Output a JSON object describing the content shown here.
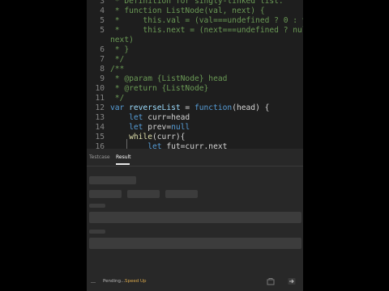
{
  "editor": {
    "lines": [
      {
        "num": "3",
        "tokens": [
          {
            "t": " * Definition for singly-linked list.",
            "c": "c-comment"
          }
        ]
      },
      {
        "num": "4",
        "tokens": [
          {
            "t": " * function ListNode(val, next) {",
            "c": "c-comment"
          }
        ]
      },
      {
        "num": "5",
        "tokens": [
          {
            "t": " *     this.val = (val===undefined ? 0 : val)",
            "c": "c-comment"
          }
        ]
      },
      {
        "num": "5",
        "tokens": [
          {
            "t": " *     this.next = (next===undefined ? null : ",
            "c": "c-comment"
          }
        ]
      },
      {
        "num": "",
        "tokens": [
          {
            "t": "next)",
            "c": "c-comment"
          }
        ]
      },
      {
        "num": "6",
        "tokens": [
          {
            "t": " * }",
            "c": "c-comment"
          }
        ]
      },
      {
        "num": "7",
        "tokens": [
          {
            "t": " */",
            "c": "c-comment"
          }
        ]
      },
      {
        "num": "8",
        "tokens": [
          {
            "t": "/**",
            "c": "c-comment"
          }
        ]
      },
      {
        "num": "9",
        "tokens": [
          {
            "t": " * @param {ListNode} head",
            "c": "c-comment"
          }
        ]
      },
      {
        "num": "10",
        "tokens": [
          {
            "t": " * @return {ListNode}",
            "c": "c-comment"
          }
        ]
      },
      {
        "num": "11",
        "tokens": [
          {
            "t": " */",
            "c": "c-comment"
          }
        ]
      },
      {
        "num": "12",
        "tokens": [
          {
            "t": "var ",
            "c": "c-kw"
          },
          {
            "t": "reverseList",
            "c": "c-var"
          },
          {
            "t": " = ",
            "c": ""
          },
          {
            "t": "function",
            "c": "c-kw"
          },
          {
            "t": "(head) {",
            "c": ""
          }
        ]
      },
      {
        "num": "13",
        "tokens": [
          {
            "t": "    ",
            "c": ""
          },
          {
            "t": "let ",
            "c": "c-kw"
          },
          {
            "t": "curr=head",
            "c": ""
          }
        ]
      },
      {
        "num": "14",
        "tokens": [
          {
            "t": "    ",
            "c": ""
          },
          {
            "t": "let ",
            "c": "c-kw"
          },
          {
            "t": "prev=",
            "c": ""
          },
          {
            "t": "null",
            "c": "c-kw"
          }
        ]
      },
      {
        "num": "15",
        "tokens": [
          {
            "t": "    ",
            "c": ""
          },
          {
            "t": "while",
            "c": "c-fn"
          },
          {
            "t": "(curr){",
            "c": ""
          }
        ]
      },
      {
        "num": "16",
        "tokens": [
          {
            "t": "        ",
            "c": ""
          },
          {
            "t": "let ",
            "c": "c-kw"
          },
          {
            "t": "fut=curr.next",
            "c": ""
          }
        ]
      }
    ]
  },
  "panel": {
    "tabs": {
      "testcase": "Testcase",
      "result": "Result"
    }
  },
  "footer": {
    "pending": "Pending...",
    "speedup": "Speed Up"
  }
}
